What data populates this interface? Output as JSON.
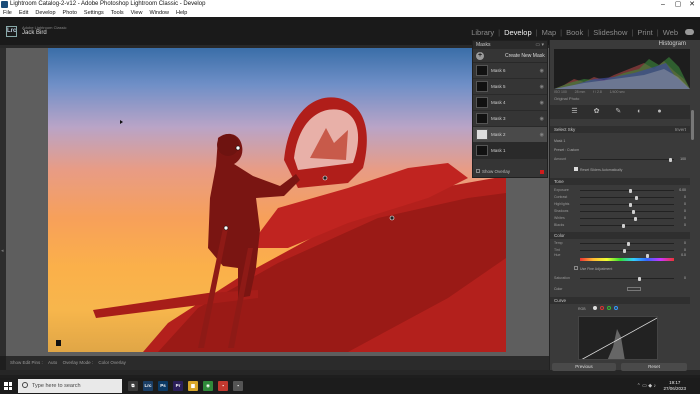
{
  "window": {
    "title": "Lightroom Catalog-2-v12 - Adobe Photoshop Lightroom Classic - Develop",
    "minimize": "–",
    "maximize": "▢",
    "close": "✕"
  },
  "menu": [
    "File",
    "Edit",
    "Develop",
    "Photo",
    "Settings",
    "Tools",
    "View",
    "Window",
    "Help"
  ],
  "identity": {
    "logo": "Lrc",
    "brand": "Adobe Lightroom Classic",
    "user": "Jack Bird"
  },
  "modules": {
    "items": [
      "Library",
      "Develop",
      "Map",
      "Book",
      "Slideshow",
      "Print",
      "Web"
    ],
    "separator": "|",
    "active": "Develop"
  },
  "masks_panel": {
    "title": "Masks",
    "create_label": "Create New Mask",
    "masks": [
      "Mask 6",
      "Mask 5",
      "Mask 4",
      "Mask 3",
      "Mask 2",
      "Mask 1"
    ],
    "selected": "Mask 2",
    "show_overlay": "Show Overlay",
    "overlay_color": "#d01c1c"
  },
  "toolbar": {
    "show_edit_pins": "Show Edit Pins :",
    "auto": "Auto",
    "overlay_mode": "Overlay Mode :",
    "color_overlay": "Color Overlay"
  },
  "right_panel": {
    "histogram_title": "Histogram",
    "hist_ticks": [
      "ISO 100",
      "28 mm",
      "f / 2.8",
      "1/400 sec"
    ],
    "original_photo": "Original Photo",
    "tools_icons": "☰ ✿ ✎ ◐ ●",
    "select_sky": "Select Sky",
    "invert": "Invert",
    "mask_label": "Mask 1",
    "preset_label": "Preset :",
    "preset_value": "Custom",
    "amount_label": "Amount",
    "amount_value": "100",
    "reset_sliders": "Reset Sliders Automatically",
    "tone_section": "Tone",
    "tone_sliders": [
      {
        "name": "Exposure",
        "value": "0.00",
        "pos": 0.52
      },
      {
        "name": "Contrast",
        "value": "0",
        "pos": 0.58
      },
      {
        "name": "Highlights",
        "value": "0",
        "pos": 0.52
      },
      {
        "name": "Shadows",
        "value": "0",
        "pos": 0.55
      },
      {
        "name": "Whites",
        "value": "0",
        "pos": 0.57
      },
      {
        "name": "Blacks",
        "value": "0",
        "pos": 0.45
      }
    ],
    "color_section": "Color",
    "temp": {
      "name": "Temp",
      "value": "0",
      "pos": 0.5
    },
    "tint": {
      "name": "Tint",
      "value": "0",
      "pos": 0.46
    },
    "hue": {
      "name": "Hue",
      "value": "0.0",
      "pos": 0.7
    },
    "fine_adjustment": "Use Fine Adjustment",
    "saturation": {
      "name": "Saturation",
      "value": "0",
      "pos": 0.62
    },
    "color_swatch_label": "Color",
    "curve_section": "Curve",
    "curve_channel": "RGB",
    "previous_button": "Previous",
    "reset_button": "Reset"
  },
  "taskbar": {
    "search_placeholder": "Type here to search",
    "time": "19:17",
    "date": "27/06/2023",
    "tray_icons": "⌃ ▭ ◆ ♪",
    "apps": [
      {
        "icon": "task-view-icon",
        "label": "⧉",
        "color": "#3a3a3a"
      },
      {
        "icon": "lightroom-icon",
        "label": "Lrc",
        "color": "#1a3e66"
      },
      {
        "icon": "photoshop-icon",
        "label": "Ps",
        "color": "#0b3a66"
      },
      {
        "icon": "premiere-icon",
        "label": "Pr",
        "color": "#2b1f5a"
      },
      {
        "icon": "file-explorer-icon",
        "label": "▆",
        "color": "#d8a72b"
      },
      {
        "icon": "chrome-icon",
        "label": "◉",
        "color": "#2f8a3a"
      },
      {
        "icon": "app-icon",
        "label": "▪",
        "color": "#c2392f"
      },
      {
        "icon": "app-icon-2",
        "label": "▪",
        "color": "#555555"
      }
    ]
  }
}
